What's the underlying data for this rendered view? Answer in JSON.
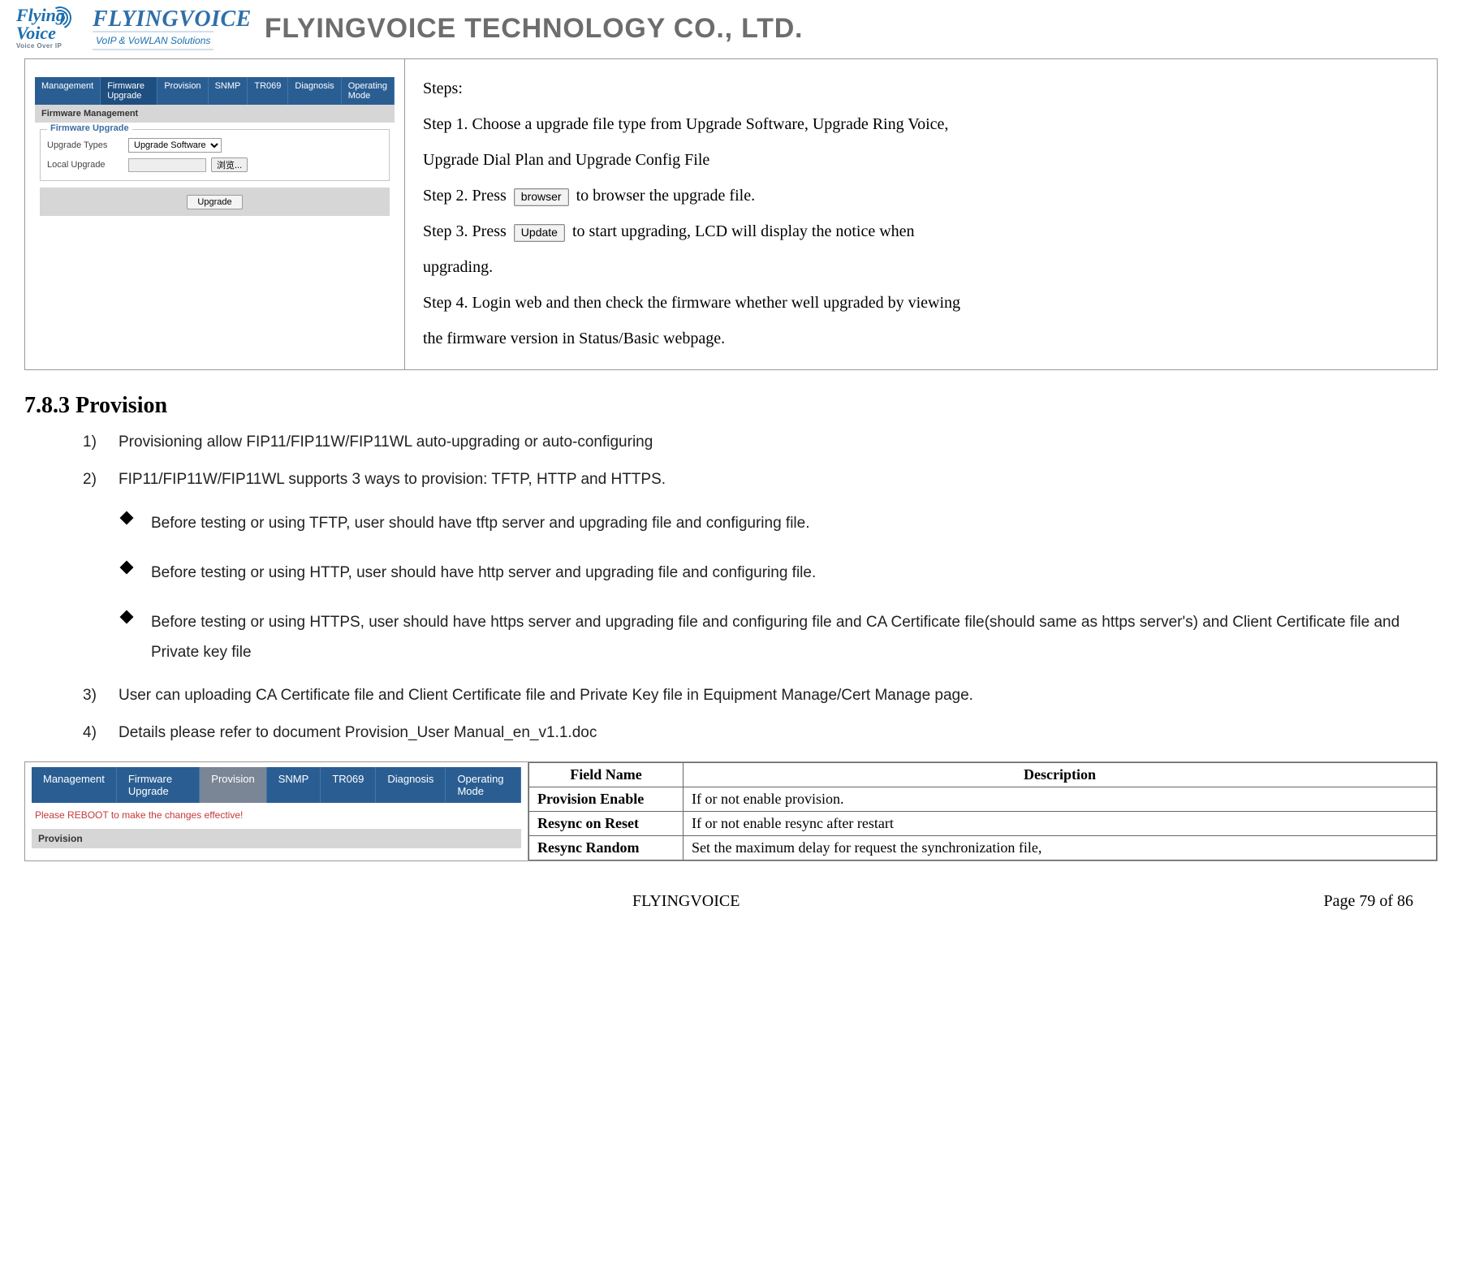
{
  "header": {
    "logo1_line1": "Flying",
    "logo1_line2": "Voice",
    "logo1_tag": "Voice Over IP",
    "logo2_brand": "FLYINGVOICE",
    "logo2_tag": "VoIP & VoWLAN Solutions",
    "company": "FLYINGVOICE TECHNOLOGY CO., LTD."
  },
  "mini": {
    "tabs": [
      "Management",
      "Firmware Upgrade",
      "Provision",
      "SNMP",
      "TR069",
      "Diagnosis",
      "Operating Mode"
    ],
    "selected_tab_index": 1,
    "panel_title": "Firmware Management",
    "legend": "Firmware Upgrade",
    "row1_label": "Upgrade Types",
    "row1_select": "Upgrade Software",
    "row2_label": "Local Upgrade",
    "row2_browse": "浏览...",
    "upgrade_btn": "Upgrade"
  },
  "steps": {
    "title": "Steps:",
    "s1a": "Step 1. Choose a upgrade file type from Upgrade Software, Upgrade Ring Voice,",
    "s1b": "Upgrade Dial Plan and Upgrade Config File",
    "s2_pre": "Step 2. Press",
    "s2_btn": "browser",
    "s2_post": " to browser the upgrade file.",
    "s3_pre": "Step 3. Press",
    "s3_btn": "Update",
    "s3_post": " to start upgrading, LCD will display the notice when",
    "s3_b": "upgrading.",
    "s4a": "Step 4. Login web and then check the firmware whether well upgraded by viewing",
    "s4b": "the firmware version in Status/Basic webpage."
  },
  "section": {
    "heading": "7.8.3   Provision",
    "items": [
      "Provisioning allow FIP11/FIP11W/FIP11WL auto-upgrading or auto-configuring",
      "FIP11/FIP11W/FIP11WL supports 3 ways to provision: TFTP, HTTP and HTTPS.",
      "User can uploading CA Certificate file and Client Certificate file and Private Key file in Equipment Manage/Cert Manage page.",
      "Details please refer to document Provision_User Manual_en_v1.1.doc"
    ],
    "diamonds": [
      "Before testing or using TFTP, user should have tftp server and upgrading file and configuring file.",
      "Before testing or using HTTP, user should have http server and upgrading file and configuring file.",
      "Before testing or using HTTPS, user should have https server and upgrading file and configuring file and CA Certificate file(should same as https server's) and Client Certificate file and Private key file"
    ]
  },
  "prov": {
    "tabs": [
      "Management",
      "Firmware Upgrade",
      "Provision",
      "SNMP",
      "TR069",
      "Diagnosis",
      "Operating Mode"
    ],
    "selected_index": 2,
    "reboot_msg": "Please REBOOT to make the changes effective!",
    "panel_title": "Provision",
    "table": {
      "hdr_field": "Field Name",
      "hdr_desc": "Description",
      "rows": [
        {
          "f": "Provision Enable",
          "d": "If or not enable provision."
        },
        {
          "f": "Resync on Reset",
          "d": "If or not enable resync after restart"
        },
        {
          "f": "Resync Random",
          "d": "Set the maximum delay for request the synchronization file,"
        }
      ]
    }
  },
  "footer": {
    "center": "FLYINGVOICE",
    "right": "Page  79  of  86"
  }
}
